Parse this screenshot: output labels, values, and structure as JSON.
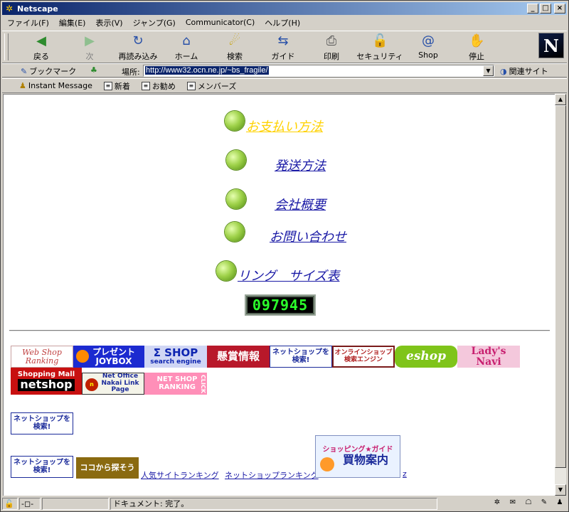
{
  "window": {
    "title": "Netscape"
  },
  "menu": [
    "ファイル(F)",
    "編集(E)",
    "表示(V)",
    "ジャンプ(G)",
    "Communicator(C)",
    "ヘルプ(H)"
  ],
  "toolbar": {
    "back": "戻る",
    "forward": "次",
    "reload": "再読み込み",
    "home": "ホーム",
    "search": "検索",
    "guide": "ガイド",
    "print": "印刷",
    "security": "セキュリティ",
    "shop": "Shop",
    "stop": "停止",
    "logo": "N"
  },
  "location": {
    "bookmarks": "ブックマーク",
    "label": "場所:",
    "url": "http://www32.ocn.ne.jp/~bs_fragile/",
    "related": "関連サイト"
  },
  "personal_toolbar": [
    "Instant Message",
    "新着",
    "お勧め",
    "メンバーズ"
  ],
  "page": {
    "nav": [
      "お支払い方法",
      "発送方法",
      "会社概要",
      "お問い合わせ",
      "リング　サイズ表"
    ],
    "counter": "097945",
    "banners": {
      "web_shop_ranking": "Web Shop Ranking",
      "present_joybox": "プレゼント JOYBOX",
      "sigma_shop": "Σ SHOP",
      "sigma_sub": "search engine",
      "kensho": "懸賞情報",
      "netshop_kensaku": "ネットショップを検索!",
      "online_shop": "オンラインショップ検索エンジン",
      "eshop": "eshop",
      "ladys_navi": "Lady's Navi",
      "shopping_mall": "Shopping Mall",
      "netshop": "netshop",
      "net_office_nakai": "Net Office Nakai Link Page",
      "net_shop_ranking": "NET SHOP RANKING",
      "click": "CLICK",
      "netshop_kensaku2": "ネットショップを検索!",
      "netshop_kensaku3": "ネットショップを検索!",
      "koko_kara": "ココから探そう",
      "shopping_guide": "ショッピング★ガイド",
      "kaimono": "買物案内"
    },
    "text_links": {
      "popular": "人気サイトランキング",
      "ranking": "ネットショップランキング",
      "z": "z"
    }
  },
  "status": {
    "text": "ドキュメント: 完了。"
  }
}
